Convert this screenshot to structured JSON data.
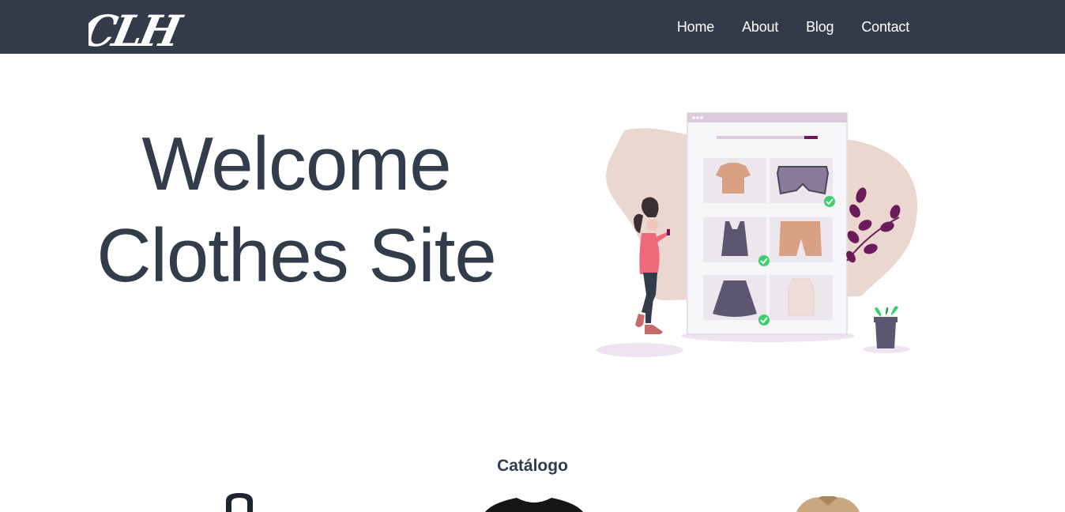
{
  "brand": {
    "logo_text": "CLH"
  },
  "nav": {
    "links": [
      {
        "label": "Home"
      },
      {
        "label": "About"
      },
      {
        "label": "Blog"
      },
      {
        "label": "Contact"
      }
    ]
  },
  "hero": {
    "line1": "Welcome",
    "line2": "Clothes Site",
    "illustration_icon": "online-shopping-illustration"
  },
  "catalog": {
    "title": "Catálogo",
    "items": [
      {
        "icon": "hoodie-icon"
      },
      {
        "icon": "t-shirt-icon"
      },
      {
        "icon": "jacket-icon"
      }
    ]
  },
  "colors": {
    "navbar": "#343b48",
    "text": "#333c4a",
    "accent_purple": "#6b1a5a",
    "check_green": "#3ccf6e",
    "blob": "#ead7d0"
  }
}
